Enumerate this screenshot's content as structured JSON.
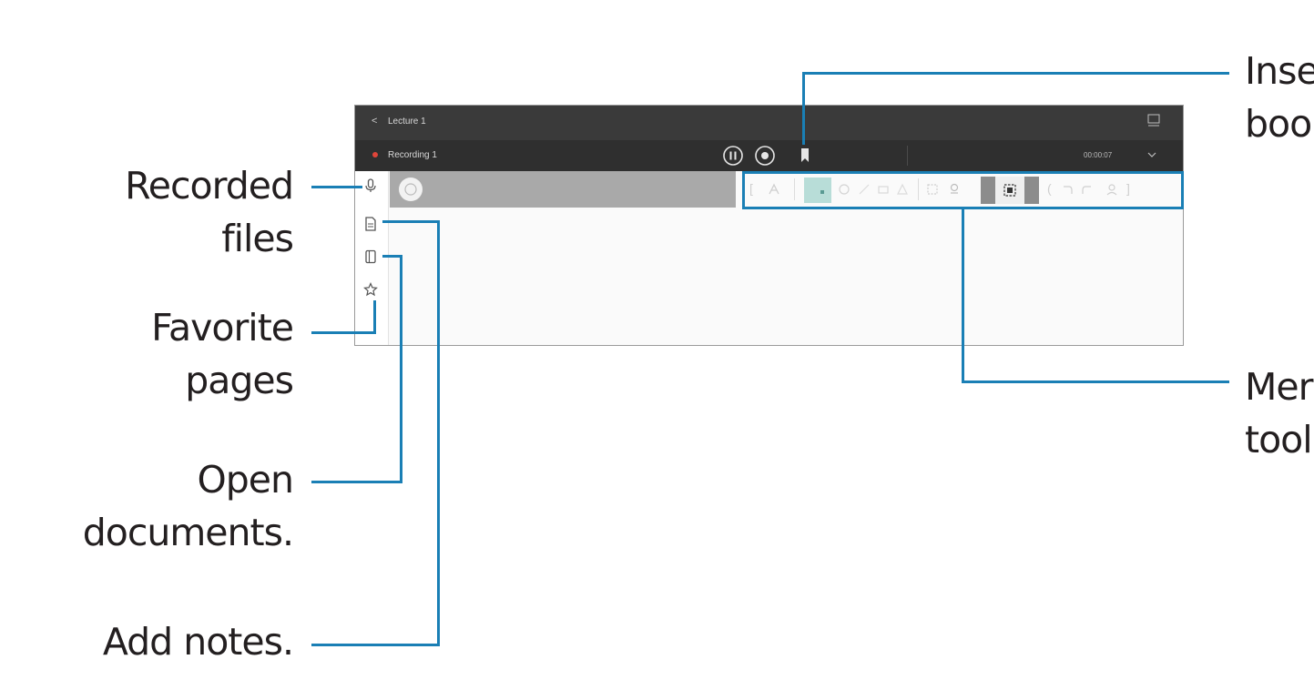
{
  "app": {
    "title": "Lecture 1",
    "recording_name": "Recording 1",
    "recording_time": "00:00:07"
  },
  "callouts": {
    "recorded_files": [
      "Recorded",
      "files"
    ],
    "favorite_pages": [
      "Favorite",
      "pages"
    ],
    "open_documents": [
      "Open",
      "documents."
    ],
    "add_notes": [
      "Add notes."
    ],
    "insert_bookmark": [
      "Inse",
      "boo"
    ],
    "menu_toolbar": [
      "Mer",
      "tool"
    ]
  },
  "colors": {
    "leader_line": "#1a7fb5",
    "recording_dot": "#e0453a"
  }
}
